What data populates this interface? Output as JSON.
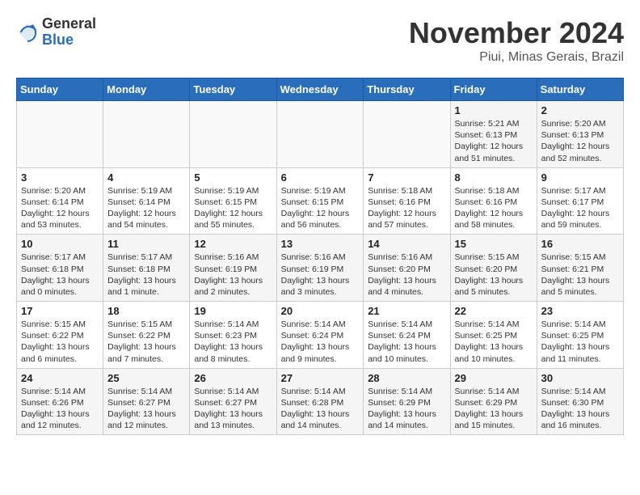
{
  "header": {
    "logo_general": "General",
    "logo_blue": "Blue",
    "month_title": "November 2024",
    "location": "Piui, Minas Gerais, Brazil"
  },
  "weekdays": [
    "Sunday",
    "Monday",
    "Tuesday",
    "Wednesday",
    "Thursday",
    "Friday",
    "Saturday"
  ],
  "weeks": [
    [
      {
        "day": "",
        "info": ""
      },
      {
        "day": "",
        "info": ""
      },
      {
        "day": "",
        "info": ""
      },
      {
        "day": "",
        "info": ""
      },
      {
        "day": "",
        "info": ""
      },
      {
        "day": "1",
        "info": "Sunrise: 5:21 AM\nSunset: 6:13 PM\nDaylight: 12 hours and 51 minutes."
      },
      {
        "day": "2",
        "info": "Sunrise: 5:20 AM\nSunset: 6:13 PM\nDaylight: 12 hours and 52 minutes."
      }
    ],
    [
      {
        "day": "3",
        "info": "Sunrise: 5:20 AM\nSunset: 6:14 PM\nDaylight: 12 hours and 53 minutes."
      },
      {
        "day": "4",
        "info": "Sunrise: 5:19 AM\nSunset: 6:14 PM\nDaylight: 12 hours and 54 minutes."
      },
      {
        "day": "5",
        "info": "Sunrise: 5:19 AM\nSunset: 6:15 PM\nDaylight: 12 hours and 55 minutes."
      },
      {
        "day": "6",
        "info": "Sunrise: 5:19 AM\nSunset: 6:15 PM\nDaylight: 12 hours and 56 minutes."
      },
      {
        "day": "7",
        "info": "Sunrise: 5:18 AM\nSunset: 6:16 PM\nDaylight: 12 hours and 57 minutes."
      },
      {
        "day": "8",
        "info": "Sunrise: 5:18 AM\nSunset: 6:16 PM\nDaylight: 12 hours and 58 minutes."
      },
      {
        "day": "9",
        "info": "Sunrise: 5:17 AM\nSunset: 6:17 PM\nDaylight: 12 hours and 59 minutes."
      }
    ],
    [
      {
        "day": "10",
        "info": "Sunrise: 5:17 AM\nSunset: 6:18 PM\nDaylight: 13 hours and 0 minutes."
      },
      {
        "day": "11",
        "info": "Sunrise: 5:17 AM\nSunset: 6:18 PM\nDaylight: 13 hours and 1 minute."
      },
      {
        "day": "12",
        "info": "Sunrise: 5:16 AM\nSunset: 6:19 PM\nDaylight: 13 hours and 2 minutes."
      },
      {
        "day": "13",
        "info": "Sunrise: 5:16 AM\nSunset: 6:19 PM\nDaylight: 13 hours and 3 minutes."
      },
      {
        "day": "14",
        "info": "Sunrise: 5:16 AM\nSunset: 6:20 PM\nDaylight: 13 hours and 4 minutes."
      },
      {
        "day": "15",
        "info": "Sunrise: 5:15 AM\nSunset: 6:20 PM\nDaylight: 13 hours and 5 minutes."
      },
      {
        "day": "16",
        "info": "Sunrise: 5:15 AM\nSunset: 6:21 PM\nDaylight: 13 hours and 5 minutes."
      }
    ],
    [
      {
        "day": "17",
        "info": "Sunrise: 5:15 AM\nSunset: 6:22 PM\nDaylight: 13 hours and 6 minutes."
      },
      {
        "day": "18",
        "info": "Sunrise: 5:15 AM\nSunset: 6:22 PM\nDaylight: 13 hours and 7 minutes."
      },
      {
        "day": "19",
        "info": "Sunrise: 5:14 AM\nSunset: 6:23 PM\nDaylight: 13 hours and 8 minutes."
      },
      {
        "day": "20",
        "info": "Sunrise: 5:14 AM\nSunset: 6:24 PM\nDaylight: 13 hours and 9 minutes."
      },
      {
        "day": "21",
        "info": "Sunrise: 5:14 AM\nSunset: 6:24 PM\nDaylight: 13 hours and 10 minutes."
      },
      {
        "day": "22",
        "info": "Sunrise: 5:14 AM\nSunset: 6:25 PM\nDaylight: 13 hours and 10 minutes."
      },
      {
        "day": "23",
        "info": "Sunrise: 5:14 AM\nSunset: 6:25 PM\nDaylight: 13 hours and 11 minutes."
      }
    ],
    [
      {
        "day": "24",
        "info": "Sunrise: 5:14 AM\nSunset: 6:26 PM\nDaylight: 13 hours and 12 minutes."
      },
      {
        "day": "25",
        "info": "Sunrise: 5:14 AM\nSunset: 6:27 PM\nDaylight: 13 hours and 12 minutes."
      },
      {
        "day": "26",
        "info": "Sunrise: 5:14 AM\nSunset: 6:27 PM\nDaylight: 13 hours and 13 minutes."
      },
      {
        "day": "27",
        "info": "Sunrise: 5:14 AM\nSunset: 6:28 PM\nDaylight: 13 hours and 14 minutes."
      },
      {
        "day": "28",
        "info": "Sunrise: 5:14 AM\nSunset: 6:29 PM\nDaylight: 13 hours and 14 minutes."
      },
      {
        "day": "29",
        "info": "Sunrise: 5:14 AM\nSunset: 6:29 PM\nDaylight: 13 hours and 15 minutes."
      },
      {
        "day": "30",
        "info": "Sunrise: 5:14 AM\nSunset: 6:30 PM\nDaylight: 13 hours and 16 minutes."
      }
    ]
  ]
}
